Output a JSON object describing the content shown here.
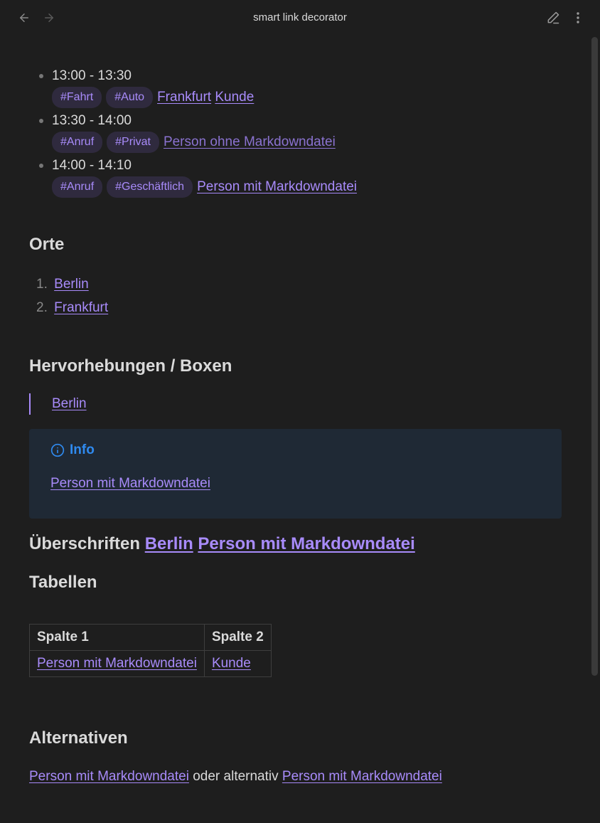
{
  "titlebar": {
    "title": "smart link decorator",
    "back_icon": "arrow-left-icon",
    "forward_icon": "arrow-right-icon",
    "edit_icon": "pencil-icon",
    "more_icon": "more-vertical-icon"
  },
  "schedule": [
    {
      "time": "13:00 - 13:30",
      "tags": [
        "#Fahrt",
        "#Auto"
      ],
      "links": [
        "Frankfurt",
        "Kunde"
      ]
    },
    {
      "time": "13:30 - 14:00",
      "tags": [
        "#Anruf",
        "#Privat"
      ],
      "links": [
        "Person ohne Markdowndatei"
      ]
    },
    {
      "time": "14:00 - 14:10",
      "tags": [
        "#Anruf",
        "#Geschäftlich"
      ],
      "links": [
        "Person mit Markdowndatei"
      ]
    }
  ],
  "orte": {
    "heading": "Orte",
    "items": [
      {
        "num": "1.",
        "label": "Berlin"
      },
      {
        "num": "2.",
        "label": "Frankfurt"
      }
    ]
  },
  "hervorhebungen": {
    "heading": "Hervorhebungen / Boxen",
    "quote_link": "Berlin",
    "callout": {
      "title": "Info",
      "icon": "info-icon",
      "link": "Person mit Markdowndatei"
    }
  },
  "ueberschriften": {
    "text": "Überschriften",
    "link1": "Berlin",
    "link2": "Person mit Markdowndatei"
  },
  "tabellen": {
    "heading": "Tabellen",
    "headers": [
      "Spalte 1",
      "Spalte 2"
    ],
    "rows": [
      [
        "Person mit Markdowndatei",
        "Kunde"
      ]
    ]
  },
  "alternativen": {
    "heading": "Alternativen",
    "link1": "Person mit Markdowndatei",
    "middle": "oder alternativ",
    "link2": "Person mit Markdowndatei"
  },
  "colors": {
    "background": "#1e1e1e",
    "link": "#a88bfa",
    "tag_bg": "#2f2a3e",
    "callout_bg": "#1f2935",
    "callout_accent": "#2f8aef"
  }
}
